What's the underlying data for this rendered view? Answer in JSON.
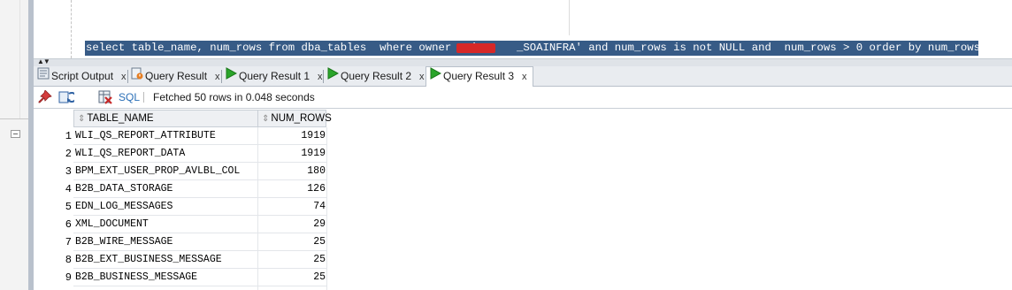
{
  "editor": {
    "sql_text": "select table_name, num_rows from dba_tables  where owner = '      _SOAINFRA' and num_rows is not NULL and  num_rows > 0 order by num_rows desc;"
  },
  "tabs": [
    {
      "label": "Script Output",
      "close": "x",
      "icon": "script-output-icon"
    },
    {
      "label": "Query Result",
      "close": "x",
      "icon": "query-result-warning-icon"
    },
    {
      "label": "Query Result 1",
      "close": "x",
      "icon": "play-icon"
    },
    {
      "label": "Query Result 2",
      "close": "x",
      "icon": "play-icon"
    },
    {
      "label": "Query Result 3",
      "close": "x",
      "icon": "play-icon",
      "active": true
    }
  ],
  "toolbar": {
    "sql_label": "SQL",
    "fetched_text": "Fetched 50 rows in 0.048 seconds"
  },
  "grid": {
    "columns": [
      "TABLE_NAME",
      "NUM_ROWS"
    ],
    "rows": [
      {
        "n": "1",
        "table_name": "WLI_QS_REPORT_ATTRIBUTE",
        "num_rows": "1919"
      },
      {
        "n": "2",
        "table_name": "WLI_QS_REPORT_DATA",
        "num_rows": "1919"
      },
      {
        "n": "3",
        "table_name": "BPM_EXT_USER_PROP_AVLBL_COL",
        "num_rows": "180"
      },
      {
        "n": "4",
        "table_name": "B2B_DATA_STORAGE",
        "num_rows": "126"
      },
      {
        "n": "5",
        "table_name": "EDN_LOG_MESSAGES",
        "num_rows": "74"
      },
      {
        "n": "6",
        "table_name": "XML_DOCUMENT",
        "num_rows": "29"
      },
      {
        "n": "7",
        "table_name": "B2B_WIRE_MESSAGE",
        "num_rows": "25"
      },
      {
        "n": "8",
        "table_name": "B2B_EXT_BUSINESS_MESSAGE",
        "num_rows": "25"
      },
      {
        "n": "9",
        "table_name": "B2B_BUSINESS_MESSAGE",
        "num_rows": "25"
      }
    ]
  },
  "colors": {
    "selection": "#375b86",
    "redaction": "#d62828",
    "play_green": "#2aa52a",
    "sql_link": "#2a6fb7"
  }
}
